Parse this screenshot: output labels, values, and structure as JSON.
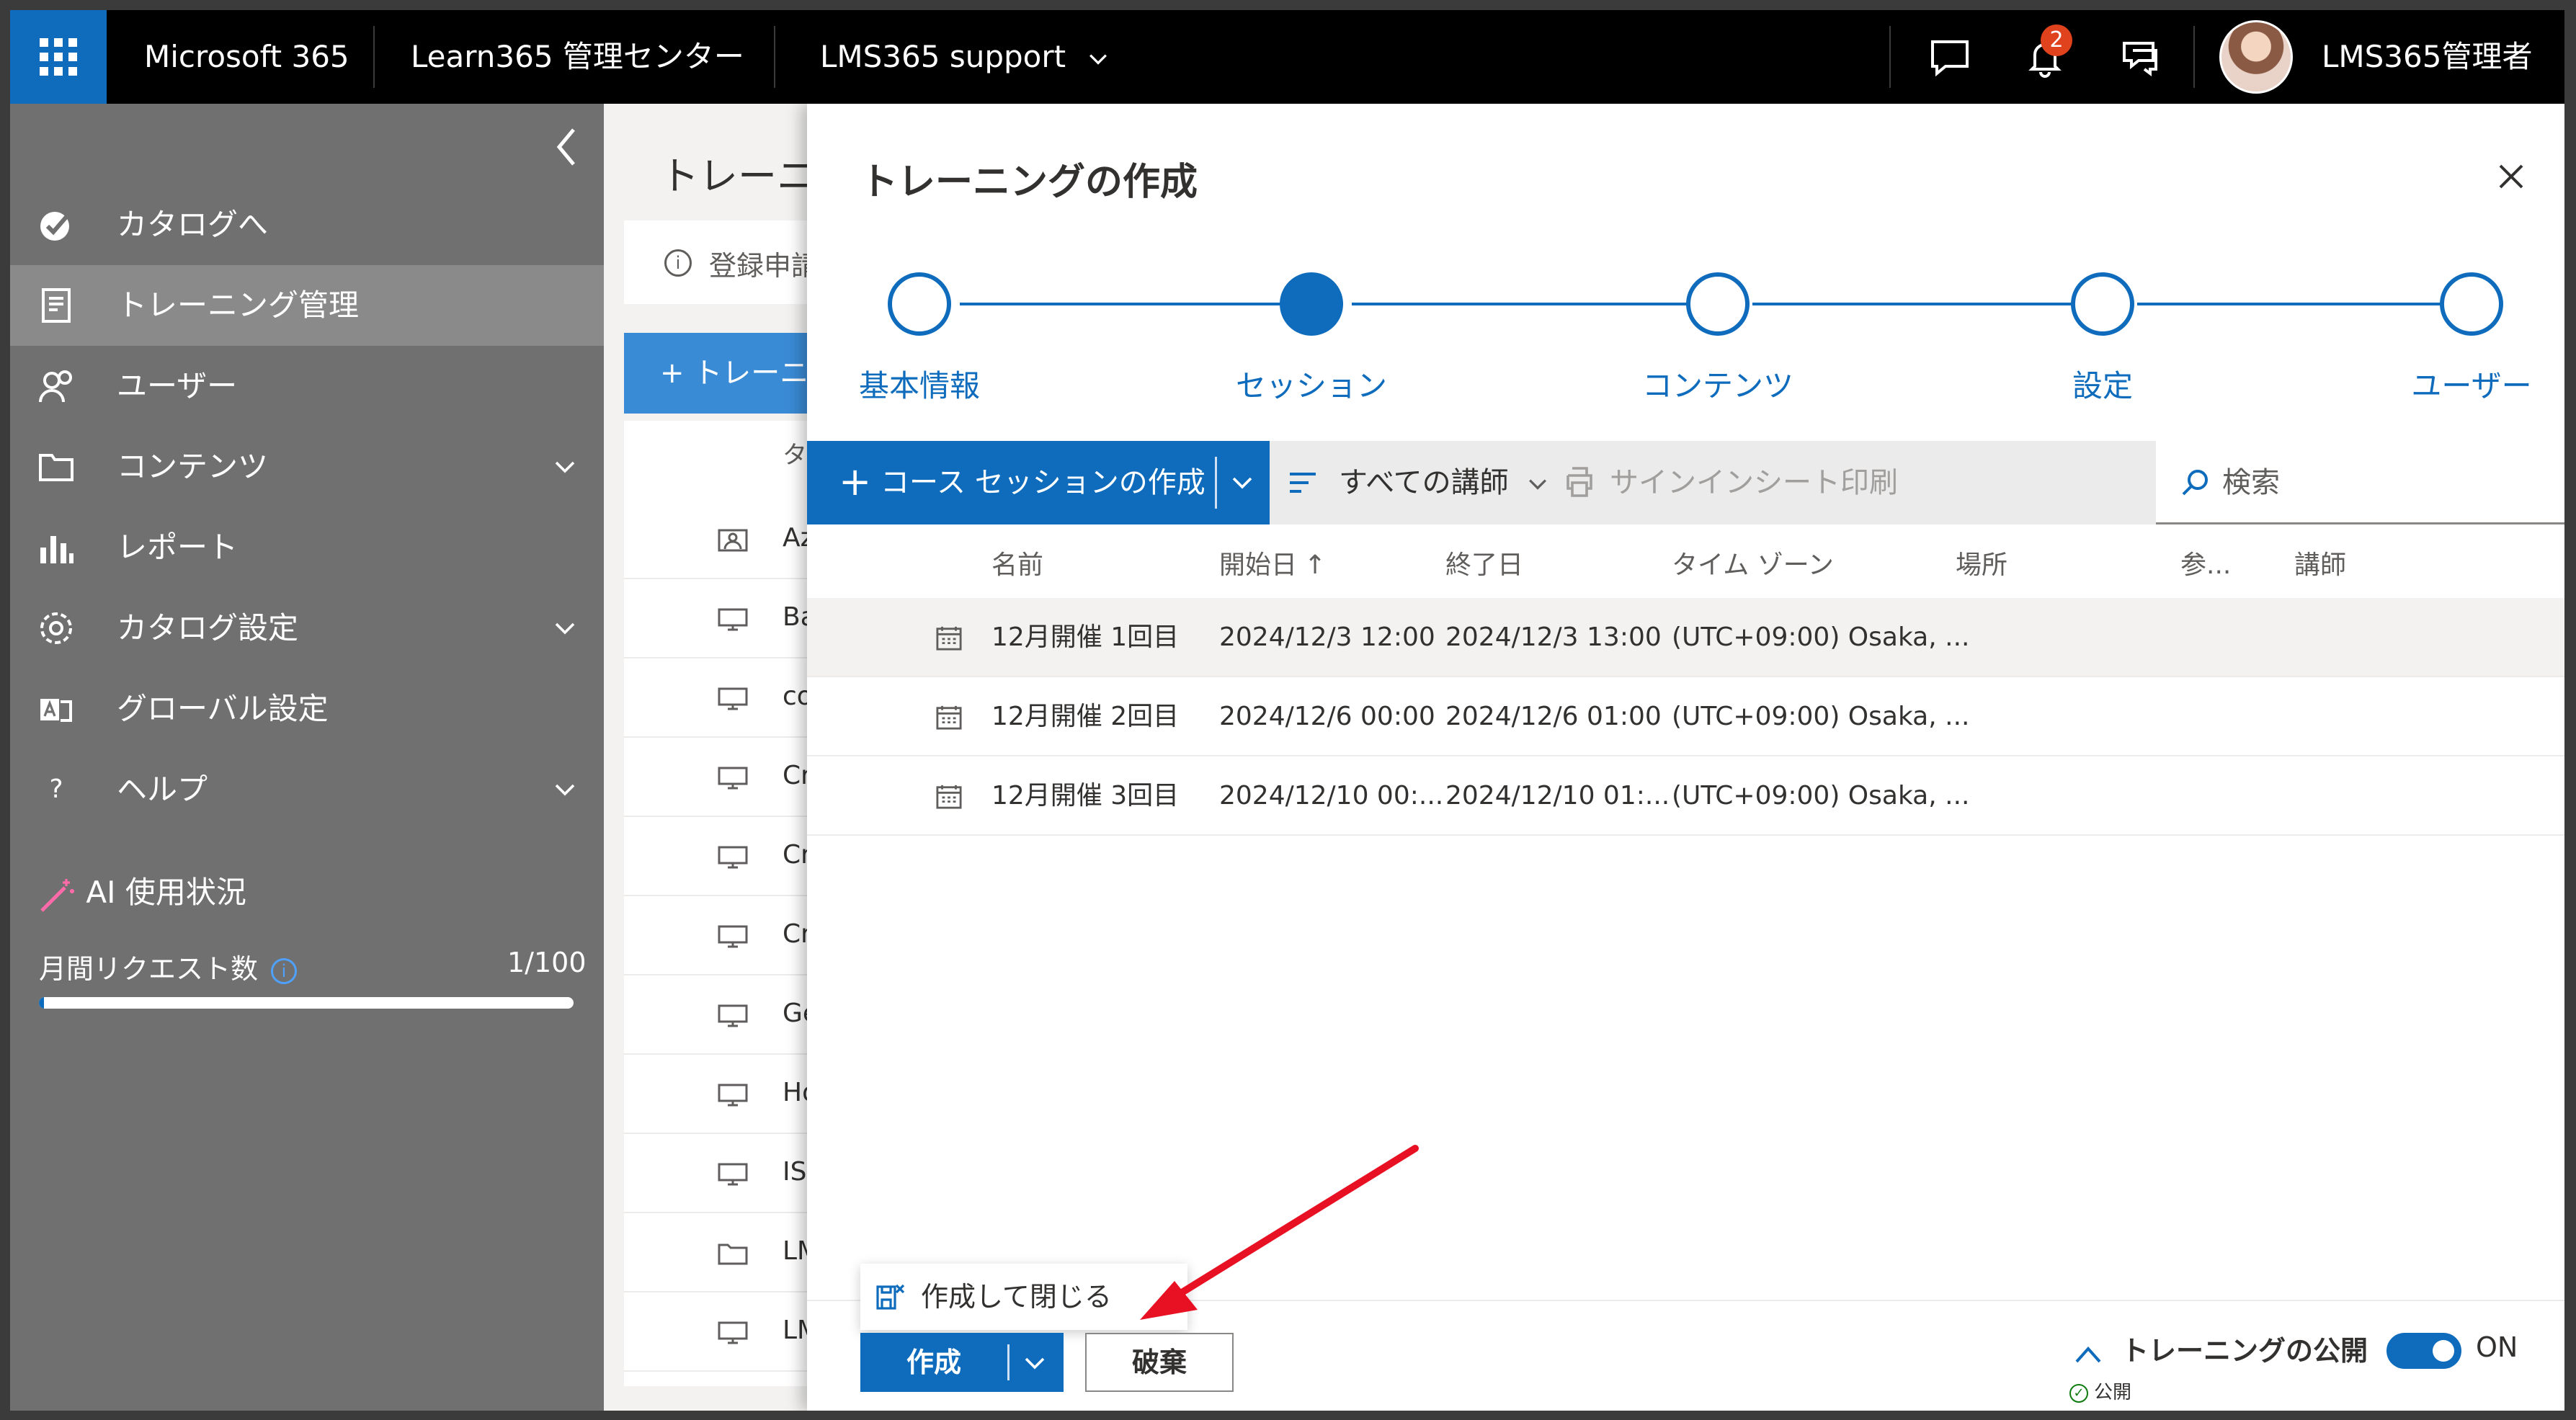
{
  "topbar": {
    "app_name": "Microsoft 365",
    "center_name": "Learn365 管理センター",
    "tenant": "LMS365 support",
    "notification_count": "2",
    "user_name": "LMS365管理者"
  },
  "nav": {
    "items": [
      {
        "label": "カタログへ",
        "icon": "catalog-check-icon"
      },
      {
        "label": "トレーニング管理",
        "icon": "training-doc-icon",
        "active": true
      },
      {
        "label": "ユーザー",
        "icon": "users-icon"
      },
      {
        "label": "コンテンツ",
        "icon": "folder-icon",
        "expandable": true
      },
      {
        "label": "レポート",
        "icon": "bar-chart-icon"
      },
      {
        "label": "カタログ設定",
        "icon": "gear-icon",
        "expandable": true
      },
      {
        "label": "グローバル設定",
        "icon": "global-settings-icon"
      },
      {
        "label": "ヘルプ",
        "icon": "help-icon",
        "expandable": true
      }
    ],
    "help_glyph": "?",
    "ai_usage_label": "AI 使用状況",
    "monthly_requests_label": "月間リクエスト数",
    "info_glyph": "i",
    "monthly_requests_count": "1/100",
    "monthly_requests_fraction": 0.01
  },
  "background": {
    "title": "トレーニン",
    "info_text": "登録申請",
    "info_glyph": "i",
    "add_button": "+ トレーニ",
    "col_header": "タイ",
    "rows": [
      {
        "text": "Azu",
        "icon": "person-card-icon"
      },
      {
        "text": "Bar",
        "icon": "monitor-icon"
      },
      {
        "text": "cou",
        "icon": "monitor-icon"
      },
      {
        "text": "Cre",
        "icon": "monitor-icon"
      },
      {
        "text": "Cre",
        "icon": "monitor-icon"
      },
      {
        "text": "Cre",
        "icon": "monitor-icon"
      },
      {
        "text": "Ge",
        "icon": "monitor-icon"
      },
      {
        "text": "Ho",
        "icon": "monitor-icon"
      },
      {
        "text": "ISC",
        "icon": "monitor-icon"
      },
      {
        "text": "LM",
        "icon": "folder-icon"
      },
      {
        "text": "LM",
        "icon": "monitor-icon"
      }
    ]
  },
  "panel": {
    "title": "トレーニングの作成",
    "steps": [
      {
        "label": "基本情報",
        "state": "pending"
      },
      {
        "label": "セッション",
        "state": "current"
      },
      {
        "label": "コンテンツ",
        "state": "pending"
      },
      {
        "label": "設定",
        "state": "pending"
      },
      {
        "label": "ユーザー",
        "state": "pending"
      }
    ],
    "toolbar": {
      "create_session": "コース セッションの作成",
      "plus_glyph": "+",
      "all_instructors": "すべての講師",
      "print_signin": "サインインシート印刷",
      "search_placeholder": "検索"
    },
    "columns": [
      "名前",
      "開始日",
      "終了日",
      "タイム ゾーン",
      "場所",
      "参...",
      "講師"
    ],
    "sort_glyph": "↑",
    "sessions": [
      {
        "name": "12月開催 1回目",
        "start": "2024/12/3 12:00",
        "end": "2024/12/3 13:00",
        "timezone": "(UTC+09:00) Osaka, ..."
      },
      {
        "name": "12月開催 2回目",
        "start": "2024/12/6 00:00",
        "end": "2024/12/6 01:00",
        "timezone": "(UTC+09:00) Osaka, ..."
      },
      {
        "name": "12月開催 3回目",
        "start": "2024/12/10 00:...",
        "end": "2024/12/10 01:...",
        "timezone": "(UTC+09:00) Osaka, ..."
      }
    ],
    "footer": {
      "create_and_close": "作成して閉じる",
      "create": "作成",
      "discard": "破棄",
      "publish_label": "トレーニングの公開",
      "publish_status": "公開",
      "check_glyph": "✓",
      "toggle_text": "ON"
    }
  },
  "colors": {
    "brand": "#0f6cbd",
    "annotation_arrow": "#e81123"
  }
}
